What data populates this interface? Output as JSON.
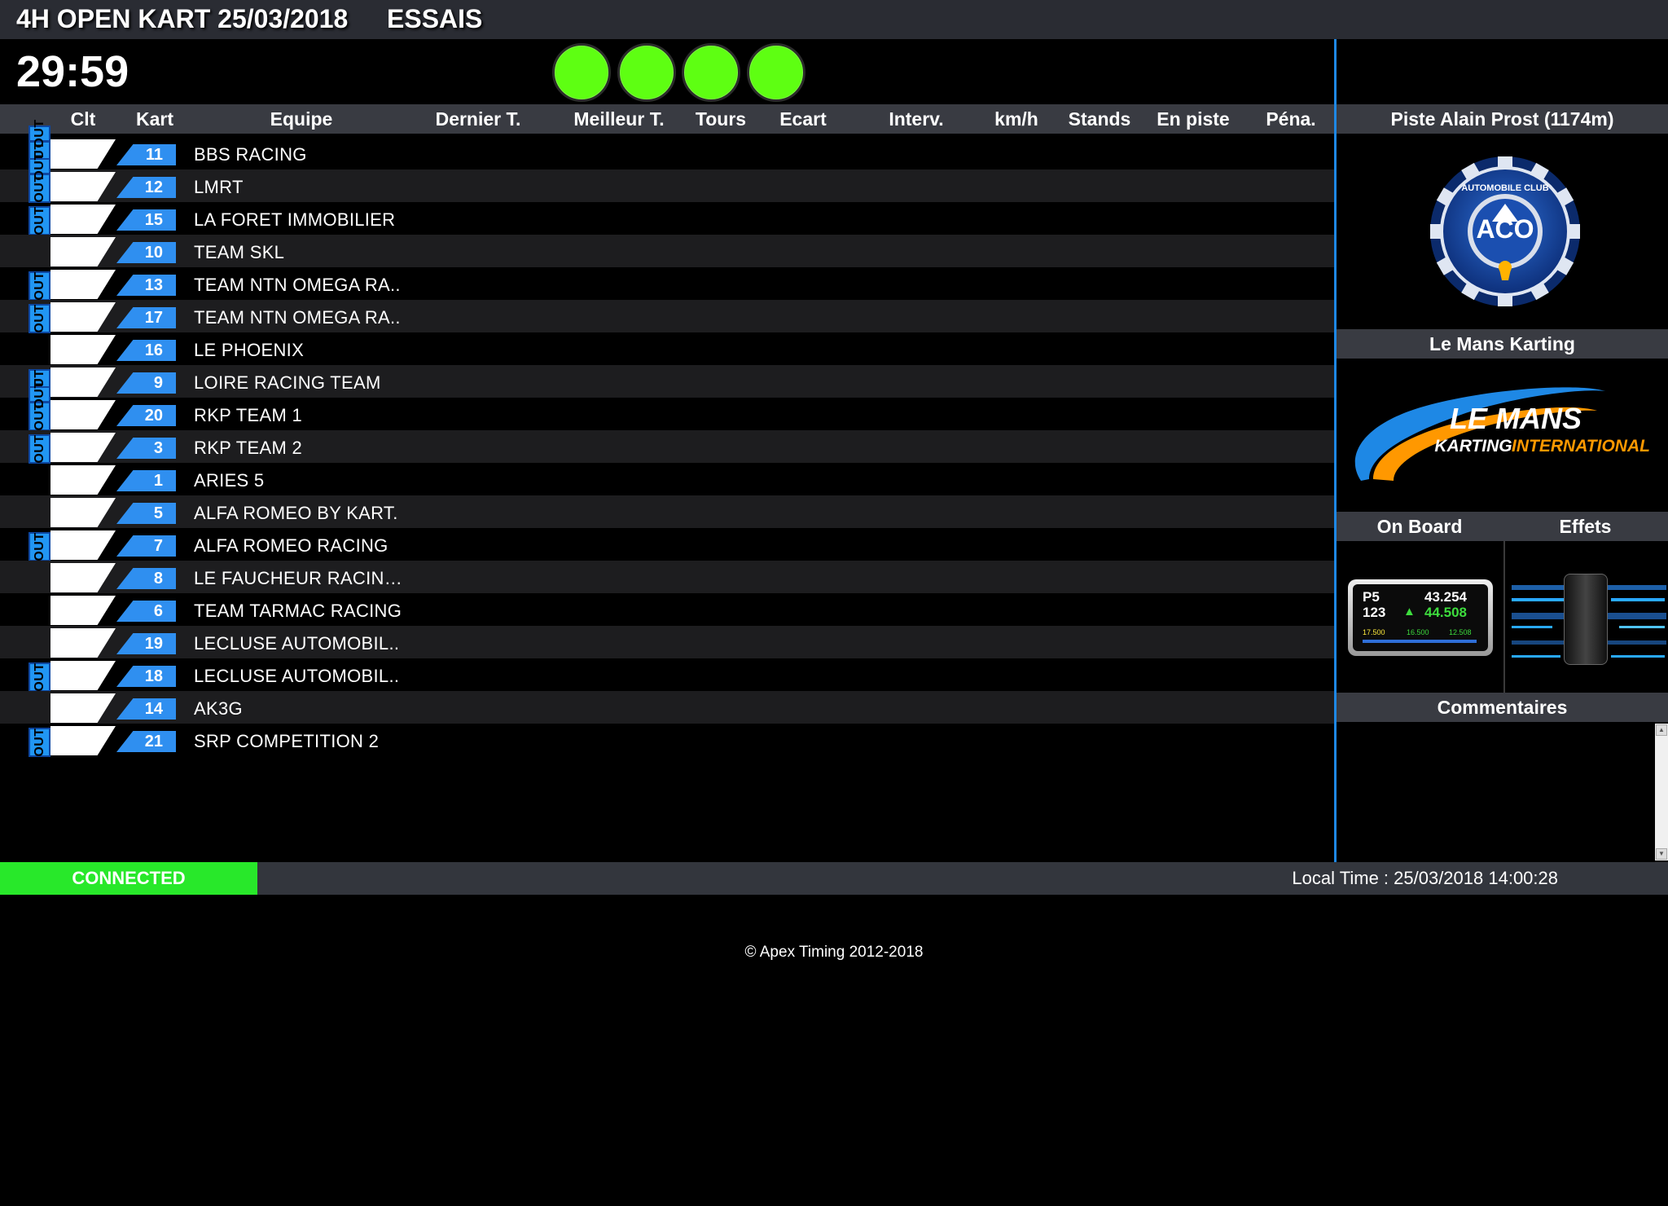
{
  "header": {
    "event_title": "4H OPEN KART 25/03/2018",
    "session": "ESSAIS"
  },
  "timer": "29:59",
  "flags": {
    "light_color": "#5eff12",
    "count": 4
  },
  "columns": [
    "Clt",
    "Kart",
    "Equipe",
    "Dernier T.",
    "Meilleur T.",
    "Tours",
    "Ecart",
    "Interv.",
    "km/h",
    "Stands",
    "En piste",
    "Péna."
  ],
  "rows": [
    {
      "kart": "11",
      "team": "BBS RACING",
      "outs": [
        "OUT",
        "OUT"
      ]
    },
    {
      "kart": "12",
      "team": "LMRT",
      "outs": [
        "OUT",
        "OUT"
      ]
    },
    {
      "kart": "15",
      "team": "LA FORET IMMOBILIER",
      "outs": [
        "OUT"
      ]
    },
    {
      "kart": "10",
      "team": "TEAM SKL",
      "outs": []
    },
    {
      "kart": "13",
      "team": "TEAM NTN OMEGA RA..",
      "outs": [
        "OUT"
      ]
    },
    {
      "kart": "17",
      "team": "TEAM NTN OMEGA RA..",
      "outs": [
        "OUT"
      ]
    },
    {
      "kart": "16",
      "team": "LE PHOENIX",
      "outs": []
    },
    {
      "kart": "9",
      "team": "LOIRE RACING TEAM",
      "outs": [
        "OUT"
      ]
    },
    {
      "kart": "20",
      "team": "RKP TEAM 1",
      "outs": [
        "OUT",
        "OUT"
      ]
    },
    {
      "kart": "3",
      "team": "RKP TEAM 2",
      "outs": [
        "OUT"
      ]
    },
    {
      "kart": "1",
      "team": "ARIES 5",
      "outs": []
    },
    {
      "kart": "5",
      "team": "ALFA ROMEO BY KART.",
      "outs": []
    },
    {
      "kart": "7",
      "team": "ALFA ROMEO RACING",
      "outs": [
        "OUT"
      ]
    },
    {
      "kart": "8",
      "team": "LE FAUCHEUR RACIN…",
      "outs": []
    },
    {
      "kart": "6",
      "team": "TEAM TARMAC RACING",
      "outs": []
    },
    {
      "kart": "19",
      "team": "LECLUSE AUTOMOBIL..",
      "outs": []
    },
    {
      "kart": "18",
      "team": "LECLUSE AUTOMOBIL..",
      "outs": [
        "OUT"
      ]
    },
    {
      "kart": "14",
      "team": "AK3G",
      "outs": []
    },
    {
      "kart": "21",
      "team": "SRP COMPETITION 2",
      "outs": [
        "OUT"
      ]
    }
  ],
  "sidebar": {
    "track_title": "Piste Alain Prost (1174m)",
    "aco_logo_text": "AUTOMOBILE CLUB",
    "aco_letters": "ACO",
    "karting_title": "Le Mans Karting",
    "karting_logo_line1": "LE MANS",
    "karting_logo_line2a": "KARTING",
    "karting_logo_line2b": "INTERNATIONAL",
    "onboard_label": "On Board",
    "effets_label": "Effets",
    "onboard_display": {
      "pos": "P5",
      "lap": "43.254",
      "kart": "123",
      "best": "44.508",
      "s1": "17.500",
      "s2": "16.500",
      "s3": "12.508"
    },
    "comments_label": "Commentaires"
  },
  "status": {
    "connection": "CONNECTED",
    "local_time": "Local Time : 25/03/2018 14:00:28"
  },
  "footer": {
    "copyright": "© Apex Timing 2012-2018"
  }
}
